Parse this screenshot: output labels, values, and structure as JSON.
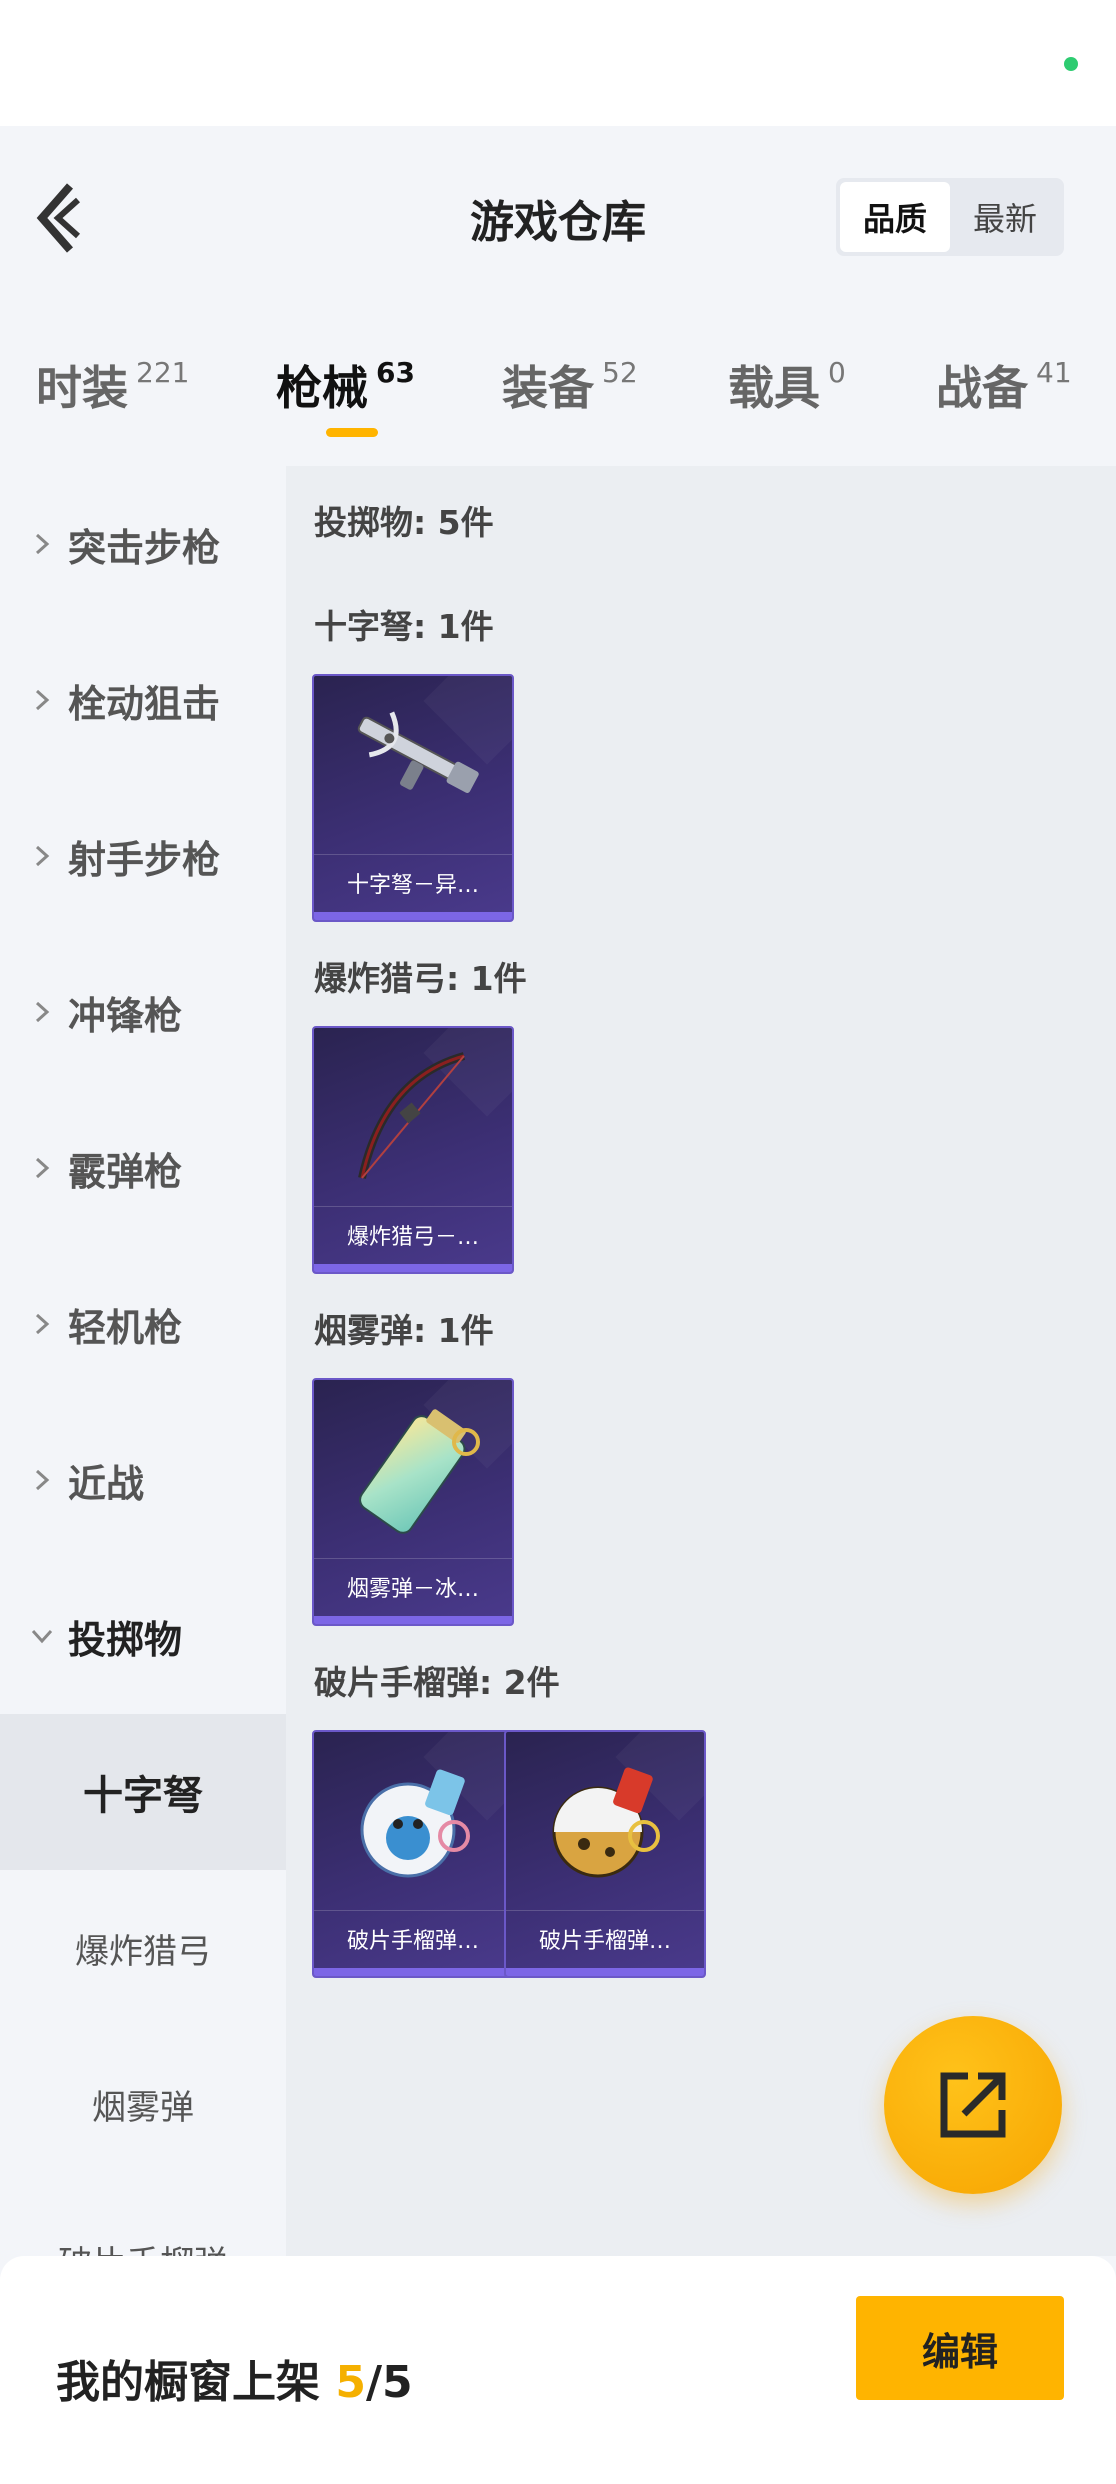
{
  "header": {
    "title": "游戏仓库",
    "sort_options": [
      "品质",
      "最新"
    ],
    "sort_active": "品质"
  },
  "tabs": [
    {
      "label": "时装",
      "count": "221"
    },
    {
      "label": "枪械",
      "count": "63",
      "active": true
    },
    {
      "label": "装备",
      "count": "52"
    },
    {
      "label": "载具",
      "count": "0"
    },
    {
      "label": "战备",
      "count": "41"
    }
  ],
  "sidebar": {
    "categories": [
      "突击步枪",
      "栓动狙击",
      "射手步枪",
      "冲锋枪",
      "霰弹枪",
      "轻机枪",
      "近战",
      "投掷物"
    ],
    "expanded": "投掷物",
    "subitems": [
      "十字弩",
      "爆炸猎弓",
      "烟雾弹",
      "破片手榴弹"
    ],
    "active_sub": "十字弩"
  },
  "content": {
    "summary": "投掷物: 5件",
    "sections": [
      {
        "title": "十字弩: 1件",
        "items": [
          "十字弩－异…"
        ]
      },
      {
        "title": "爆炸猎弓: 1件",
        "items": [
          "爆炸猎弓－…"
        ]
      },
      {
        "title": "烟雾弹: 1件",
        "items": [
          "烟雾弹－冰…"
        ]
      },
      {
        "title": "破片手榴弹: 2件",
        "items": [
          "破片手榴弹…",
          "破片手榴弹…"
        ]
      }
    ]
  },
  "bottom": {
    "shelf_label": "我的橱窗上架",
    "shelf_used": "5",
    "shelf_total": "/5",
    "edit_label": "编辑"
  },
  "colors": {
    "accent": "#ffb400",
    "card_bg": "#3c2f74",
    "card_border": "#6b58c8",
    "status_dot": "#2ecc71"
  },
  "icons": {
    "back": "chevron-left-icon",
    "collapsed": "chevron-right-icon",
    "expanded": "chevron-down-icon",
    "fab": "share-external-icon"
  }
}
